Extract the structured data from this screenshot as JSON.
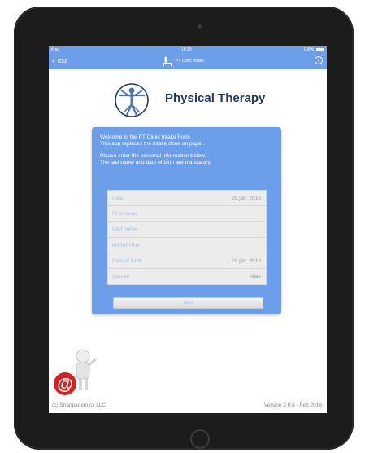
{
  "status_bar": {
    "carrier": "iPad",
    "time": "16:20",
    "battery": "100%"
  },
  "nav": {
    "back_label": "Tour",
    "title": "PT Clinic Intake"
  },
  "hero": {
    "title": "Physical Therapy"
  },
  "intro": {
    "line1": "Welcome to the PT Clinic Intake Form.",
    "line2": "This app replaces the intake done on paper.",
    "line3": "Please enter the personal information below.",
    "line4": "The last name and date of birth are mandatory."
  },
  "form": {
    "rows": [
      {
        "label": "Date",
        "value": "29 jan. 2016"
      },
      {
        "label": "First name",
        "value": ""
      },
      {
        "label": "Last name",
        "value": ""
      },
      {
        "label": "MRN/PHN#",
        "value": ""
      },
      {
        "label": "Date of birth",
        "value": "29 jan. 2016"
      },
      {
        "label": "Gender",
        "value": "Male"
      }
    ],
    "next_label": "Next"
  },
  "footer": {
    "copyright": "(c) Snappademics LLC",
    "version": "Version 2.0.8 - Feb 2016"
  },
  "colors": {
    "accent": "#6d9eea",
    "hero_title": "#1f3a63",
    "row_bg": "#ececec"
  },
  "icons": {
    "back": "chevron-left-icon",
    "info": "info-icon",
    "title": "therapy-table-icon",
    "logo": "vitruvian-man-logo",
    "mascot": "email-mascot"
  }
}
